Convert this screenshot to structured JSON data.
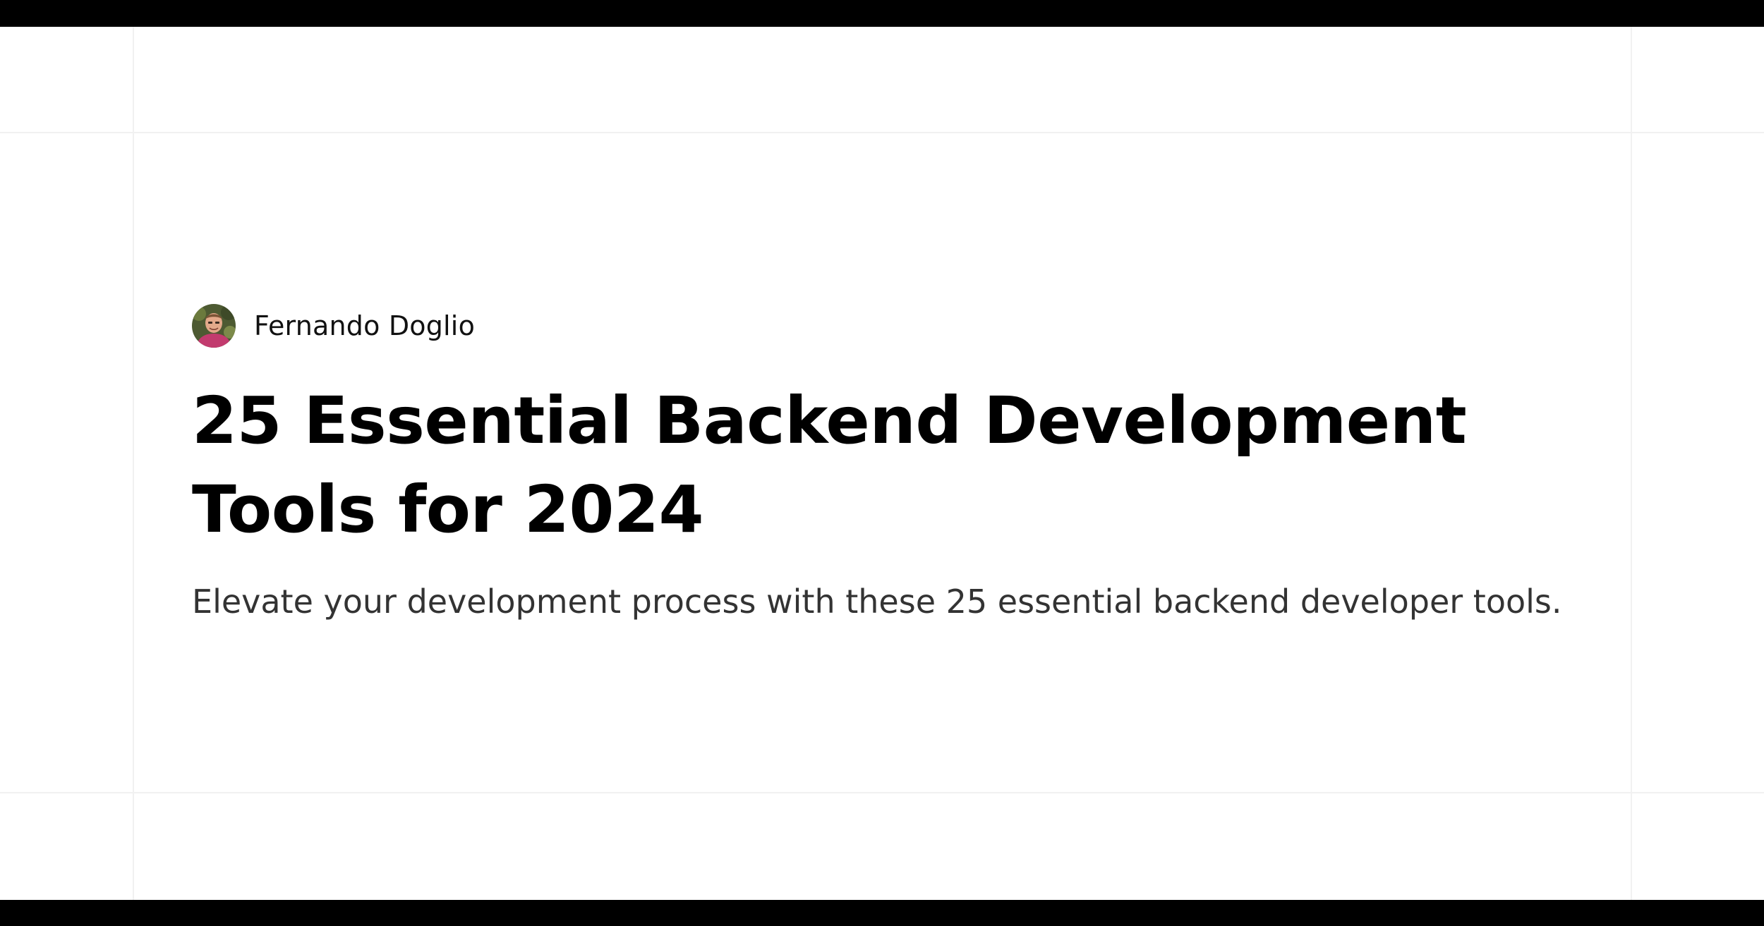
{
  "article": {
    "author": {
      "name": "Fernando Doglio",
      "avatar_icon": "avatar-photo-icon"
    },
    "title": "25 Essential Backend Development Tools for 2024",
    "subtitle": "Elevate your development process with these 25 essential backend developer tools."
  },
  "colors": {
    "background": "#ffffff",
    "frame_bar": "#000000",
    "gridline": "#f1f1f1",
    "title": "#000000",
    "subtitle": "#333333"
  }
}
